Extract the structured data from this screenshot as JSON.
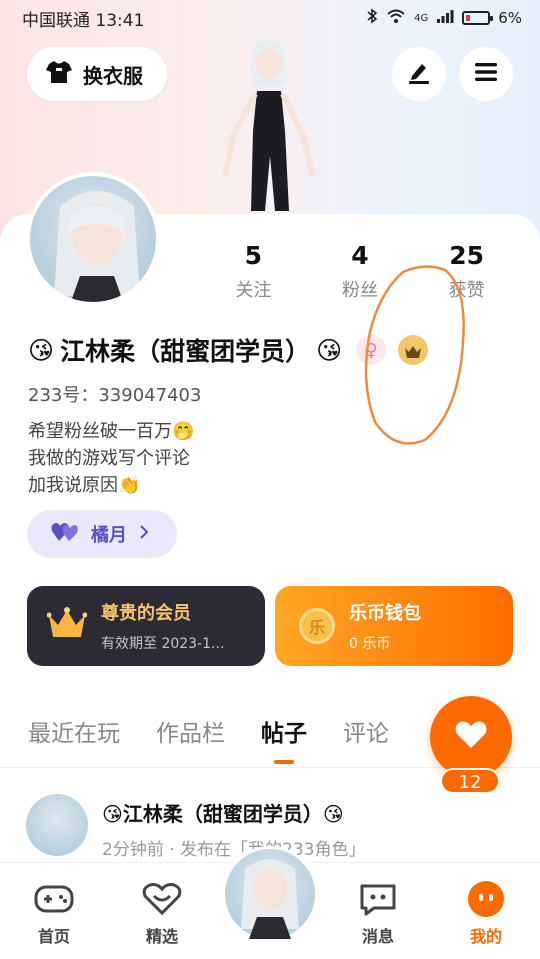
{
  "status_bar": {
    "carrier_time": "中国联通 13:41",
    "battery": "6%",
    "network": "4G"
  },
  "top": {
    "dress_label": "换衣服"
  },
  "stats": [
    {
      "num": "5",
      "label": "关注"
    },
    {
      "num": "4",
      "label": "粉丝"
    },
    {
      "num": "25",
      "label": "获赞"
    }
  ],
  "profile": {
    "emoji_left": "😘",
    "name": "江林柔（甜蜜团学员）",
    "emoji_right": "😘",
    "female_symbol": "♀",
    "uid": "233号：339047403",
    "bio": [
      "希望粉丝破一百万🤭",
      "我做的游戏写个评论",
      "加我说原因👏"
    ],
    "tag_label": "橘月"
  },
  "vip": {
    "title": "尊贵的会员",
    "subtitle": "有效期至 2023-1..."
  },
  "wallet": {
    "title": "乐币钱包",
    "subtitle": "0 乐币",
    "coin_char": "乐"
  },
  "tabs": [
    "最近在玩",
    "作品栏",
    "帖子",
    "评论"
  ],
  "active_tab": "帖子",
  "like_count": "12",
  "post": {
    "name": "😘江林柔（甜蜜团学员）😘",
    "meta": "2分钟前 · 发布在「我的233角色」"
  },
  "bottom_nav": [
    {
      "label": "首页",
      "icon": "gamepad-icon"
    },
    {
      "label": "精选",
      "icon": "heart-shield-icon"
    },
    {
      "label": "消息",
      "icon": "chat-icon"
    },
    {
      "label": "我的",
      "icon": "profile-face-icon"
    }
  ],
  "colors": {
    "accent": "#ff6a00",
    "vip_gold": "#f7c56b",
    "tag_purple": "#5b4fc4",
    "annotation": "#f08a3c"
  }
}
